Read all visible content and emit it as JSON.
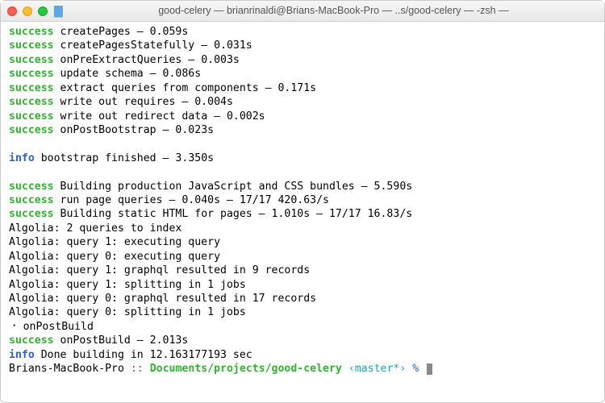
{
  "window": {
    "title": "good-celery — brianrinaldi@Brians-MacBook-Pro — ..s/good-celery — -zsh — "
  },
  "lines": {
    "l1": {
      "prefix": "success",
      "text": " createPages — 0.059s"
    },
    "l2": {
      "prefix": "success",
      "text": " createPagesStatefully — 0.031s"
    },
    "l3": {
      "prefix": "success",
      "text": " onPreExtractQueries — 0.003s"
    },
    "l4": {
      "prefix": "success",
      "text": " update schema — 0.086s"
    },
    "l5": {
      "prefix": "success",
      "text": " extract queries from components — 0.171s"
    },
    "l6": {
      "prefix": "success",
      "text": " write out requires — 0.004s"
    },
    "l7": {
      "prefix": "success",
      "text": " write out redirect data — 0.002s"
    },
    "l8": {
      "prefix": "success",
      "text": " onPostBootstrap — 0.023s"
    },
    "l9": {
      "prefix": "info",
      "text": " bootstrap finished — 3.350s"
    },
    "l10": {
      "prefix": "success",
      "text": " Building production JavaScript and CSS bundles — 5.590s"
    },
    "l11": {
      "prefix": "success",
      "text": " run page queries — 0.040s — 17/17 420.63/s"
    },
    "l12": {
      "prefix": "success",
      "text": " Building static HTML for pages — 1.010s — 17/17 16.83/s"
    },
    "a1": "Algolia: 2 queries to index",
    "a2": "Algolia: query 1: executing query",
    "a3": "Algolia: query 0: executing query",
    "a4": "Algolia: query 1: graphql resulted in 9 records",
    "a5": "Algolia: query 1: splitting in 1 jobs",
    "a6": "Algolia: query 0: graphql resulted in 17 records",
    "a7": "Algolia: query 0: splitting in 1 jobs",
    "spin": "⠐ onPostBuild",
    "l13": {
      "prefix": "success",
      "text": " onPostBuild — 2.013s"
    },
    "l14": {
      "prefix": "info",
      "text": " Done building in 12.163177193 sec"
    }
  },
  "prompt": {
    "host": "Brians-MacBook-Pro",
    "sep": " :: ",
    "path": "Documents/projects/good-celery",
    "branch_open": " ‹",
    "branch": "master*",
    "branch_close": "›",
    "sigil": " % "
  }
}
